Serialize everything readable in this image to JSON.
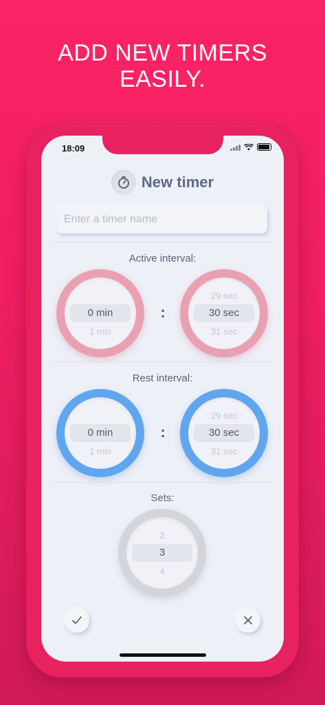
{
  "headline": {
    "line1": "ADD NEW TIMERS",
    "line2": "EASILY."
  },
  "status": {
    "time": "18:09"
  },
  "title": "New timer",
  "name_input": {
    "placeholder": "Enter a timer name",
    "value": ""
  },
  "active": {
    "label": "Active interval:",
    "minutes": {
      "selected": "0 min",
      "next": "1 min"
    },
    "seconds": {
      "prev": "29 sec",
      "selected": "30 sec",
      "next": "31 sec"
    },
    "separator": ":"
  },
  "rest": {
    "label": "Rest interval:",
    "minutes": {
      "selected": "0 min",
      "next": "1 min"
    },
    "seconds": {
      "prev": "29 sec",
      "selected": "30 sec",
      "next": "31 sec"
    },
    "separator": ":"
  },
  "sets": {
    "label": "Sets:",
    "prev": "2",
    "selected": "3",
    "next": "4"
  },
  "colors": {
    "background": "#fb2366",
    "active_ring": "#e9a1b2",
    "rest_ring": "#5fa6ef",
    "sets_ring": "#d3d5db",
    "text_primary": "#5e6a86"
  },
  "icons": {
    "title": "stopwatch-icon",
    "confirm": "checkmark-icon",
    "cancel": "close-icon"
  }
}
